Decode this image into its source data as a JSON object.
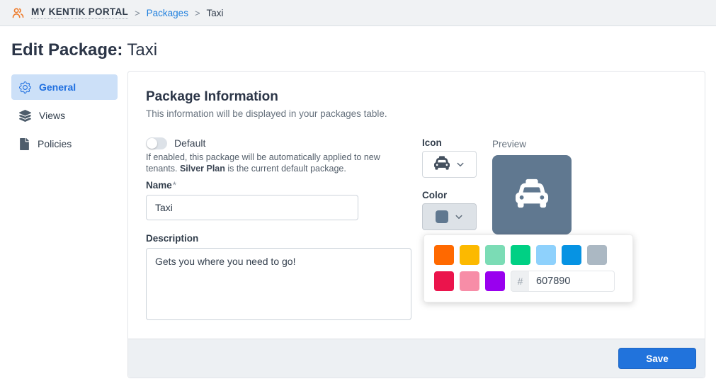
{
  "topbar": {
    "portal_label": "MY KENTIK PORTAL",
    "separator": ">",
    "crumbs": [
      {
        "label": "Packages"
      },
      {
        "label": "Taxi"
      }
    ]
  },
  "page_title": {
    "bold": "Edit Package:",
    "name": "Taxi"
  },
  "sidebar": {
    "items": [
      {
        "label": "General",
        "icon": "gear-icon",
        "active": true
      },
      {
        "label": "Views",
        "icon": "layers-icon",
        "active": false
      },
      {
        "label": "Policies",
        "icon": "file-icon",
        "active": false
      }
    ]
  },
  "card": {
    "heading": "Package Information",
    "subheading": "This information will be displayed in your packages table.",
    "default_toggle": {
      "label": "Default",
      "state": "off",
      "help_prefix": "If enabled, this package will be automatically applied to new tenants. ",
      "help_bold": "Silver Plan",
      "help_suffix": " is the current default package."
    },
    "name_field": {
      "label": "Name",
      "required_mark": "*",
      "value": "Taxi"
    },
    "description_field": {
      "label": "Description",
      "value": "Gets you where you need to go!"
    },
    "icon_field": {
      "label": "Icon",
      "value": "taxi-icon"
    },
    "color_field": {
      "label": "Color",
      "value": "#607890"
    },
    "preview": {
      "label": "Preview",
      "color": "#607890",
      "icon": "taxi-icon"
    },
    "save_label": "Save"
  },
  "color_picker": {
    "swatches": [
      "#FF6900",
      "#FCB900",
      "#7BDCB5",
      "#00D084",
      "#8ED1FC",
      "#0693E3",
      "#ABB8C3",
      "#EB144C",
      "#F78DA7",
      "#9900EF"
    ],
    "hex_prefix": "#",
    "hex_value": "607890"
  }
}
